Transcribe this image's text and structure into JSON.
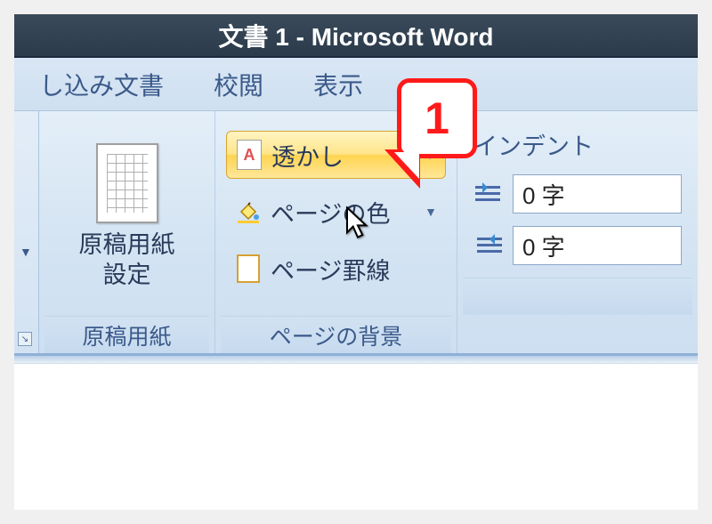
{
  "title": "文書 1 - Microsoft Word",
  "tabs": {
    "mailings": "し込み文書",
    "review": "校閲",
    "view": "表示"
  },
  "groups": {
    "genkoyoshi": {
      "button": "原稿用紙\n設定",
      "label": "原稿用紙"
    },
    "page_background": {
      "watermark": "透かし",
      "page_color": "ページの色",
      "page_borders": "ページ罫線",
      "label": "ページの背景",
      "watermark_icon_letter": "A"
    },
    "indent": {
      "title": "インデント",
      "left_value": "0 字",
      "right_value": "0 字"
    }
  },
  "callout": {
    "number": "1"
  }
}
